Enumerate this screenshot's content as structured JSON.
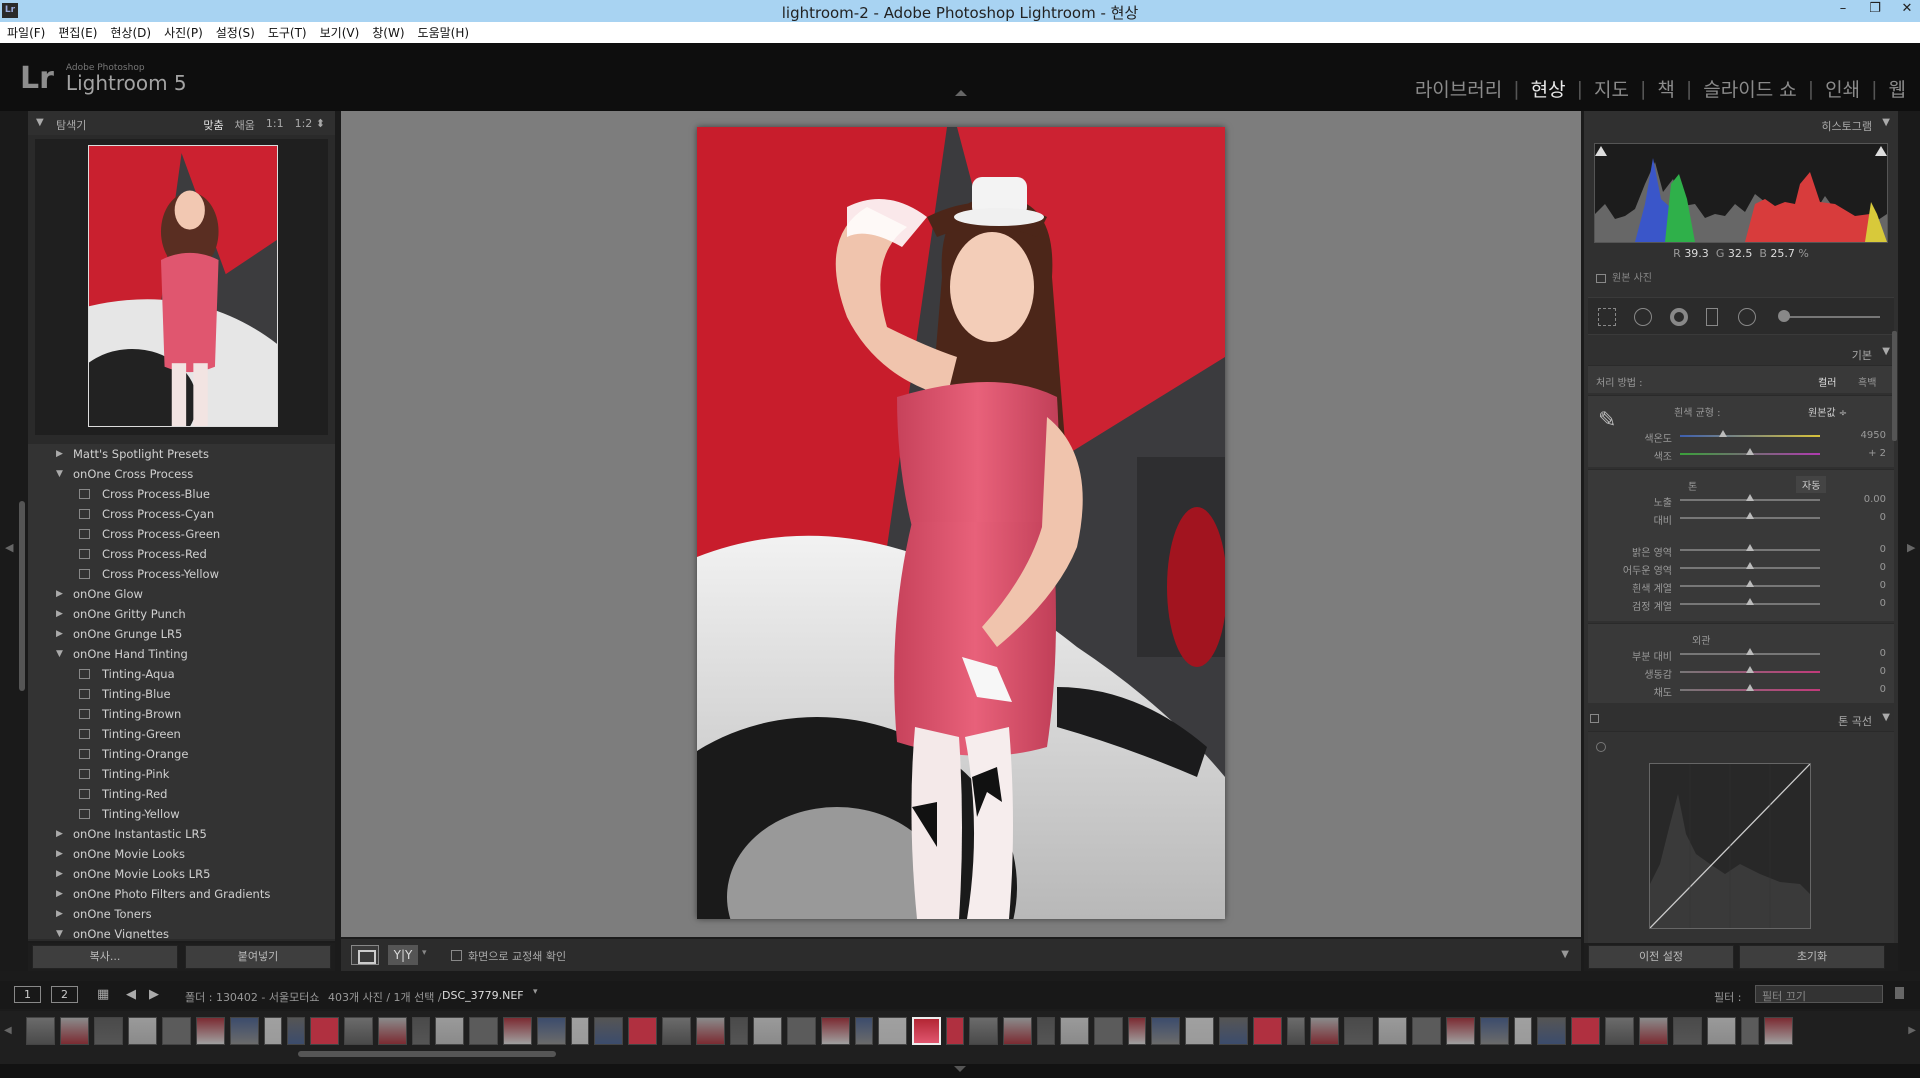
{
  "window": {
    "title": "lightroom-2 - Adobe Photoshop Lightroom - 현상",
    "app_icon": "Lr",
    "controls": [
      "–",
      "❐",
      "✕"
    ]
  },
  "menu": [
    "파일(F)",
    "편집(E)",
    "현상(D)",
    "사진(P)",
    "설정(S)",
    "도구(T)",
    "보기(V)",
    "창(W)",
    "도움말(H)"
  ],
  "logo": {
    "mark": "Lr",
    "small": "Adobe Photoshop",
    "name": "Lightroom 5"
  },
  "modules": [
    "라이브러리",
    "현상",
    "지도",
    "책",
    "슬라이드 쇼",
    "인쇄",
    "웹"
  ],
  "active_module": "현상",
  "navigator": {
    "label": "탐색기",
    "options": [
      "맞춤",
      "채움",
      "1:1",
      "1:2 ⬍"
    ],
    "active_option": "맞춤"
  },
  "presets": [
    {
      "type": "folder",
      "label": "Matt's Spotlight Presets",
      "open": false
    },
    {
      "type": "folder",
      "label": "onOne Cross Process",
      "open": true
    },
    {
      "type": "item",
      "label": "Cross Process-Blue"
    },
    {
      "type": "item",
      "label": "Cross Process-Cyan"
    },
    {
      "type": "item",
      "label": "Cross Process-Green"
    },
    {
      "type": "item",
      "label": "Cross Process-Red"
    },
    {
      "type": "item",
      "label": "Cross Process-Yellow"
    },
    {
      "type": "folder",
      "label": "onOne Glow",
      "open": false
    },
    {
      "type": "folder",
      "label": "onOne Gritty Punch",
      "open": false
    },
    {
      "type": "folder",
      "label": "onOne Grunge LR5",
      "open": false
    },
    {
      "type": "folder",
      "label": "onOne Hand Tinting",
      "open": true
    },
    {
      "type": "item",
      "label": "Tinting-Aqua"
    },
    {
      "type": "item",
      "label": "Tinting-Blue"
    },
    {
      "type": "item",
      "label": "Tinting-Brown"
    },
    {
      "type": "item",
      "label": "Tinting-Green"
    },
    {
      "type": "item",
      "label": "Tinting-Orange"
    },
    {
      "type": "item",
      "label": "Tinting-Pink"
    },
    {
      "type": "item",
      "label": "Tinting-Red"
    },
    {
      "type": "item",
      "label": "Tinting-Yellow"
    },
    {
      "type": "folder",
      "label": "onOne Instantastic LR5",
      "open": false
    },
    {
      "type": "folder",
      "label": "onOne Movie Looks",
      "open": false
    },
    {
      "type": "folder",
      "label": "onOne Movie Looks LR5",
      "open": false
    },
    {
      "type": "folder",
      "label": "onOne Photo Filters and Gradients",
      "open": false
    },
    {
      "type": "folder",
      "label": "onOne Toners",
      "open": false
    },
    {
      "type": "folder",
      "label": "onOne Vignettes",
      "open": true
    }
  ],
  "left_buttons": {
    "copy": "복사...",
    "paste": "붙여넣기"
  },
  "toolbar": {
    "yy": "Y|Y",
    "caret": "▾",
    "soft_proof": "화면으로 교정쇄 확인",
    "menu_caret": "▼"
  },
  "histogram": {
    "label": "히스토그램",
    "r_label": "R",
    "r": "39.3",
    "g_label": "G",
    "g": "32.5",
    "b_label": "B",
    "b": "25.7",
    "unit": "%",
    "original": "원본 사진"
  },
  "basic": {
    "label": "기본",
    "treatment_label": "처리 방법 :",
    "treatment_color": "컬러",
    "treatment_bw": "흑백",
    "wb_label": "흰색 균형 :",
    "wb_value": "원본값 ÷",
    "temp_label": "색온도",
    "temp_value": "4950",
    "tint_label": "색조",
    "tint_value": "+ 2",
    "tone_label": "톤",
    "auto_label": "자동",
    "exposure_label": "노출",
    "exposure_value": "0.00",
    "contrast_label": "대비",
    "contrast_value": "0",
    "highlights_label": "밝은 영역",
    "highlights_value": "0",
    "shadows_label": "어두운 영역",
    "shadows_value": "0",
    "whites_label": "흰색 계열",
    "whites_value": "0",
    "blacks_label": "검정 계열",
    "blacks_value": "0",
    "presence_label": "외관",
    "clarity_label": "부분 대비",
    "clarity_value": "0",
    "vibrance_label": "생동감",
    "vibrance_value": "0",
    "saturation_label": "채도",
    "saturation_value": "0"
  },
  "tone_curve": {
    "label": "톤 곡선"
  },
  "right_buttons": {
    "previous": "이전 설정",
    "reset": "초기화"
  },
  "filmstrip": {
    "monitor1": "1",
    "monitor2": "2",
    "folder_label": "폴더 : 130402 - 서울모터쇼",
    "count": "403개 사진 / 1개 선택 /",
    "filename": "DSC_3779.NEF",
    "filter_label": "필터 :",
    "filter_value": "필터 끄기"
  },
  "colors": {
    "accent": "#e8e8e8",
    "panel": "#303030",
    "background": "#7d7d7d",
    "dress": "#e0566f"
  }
}
